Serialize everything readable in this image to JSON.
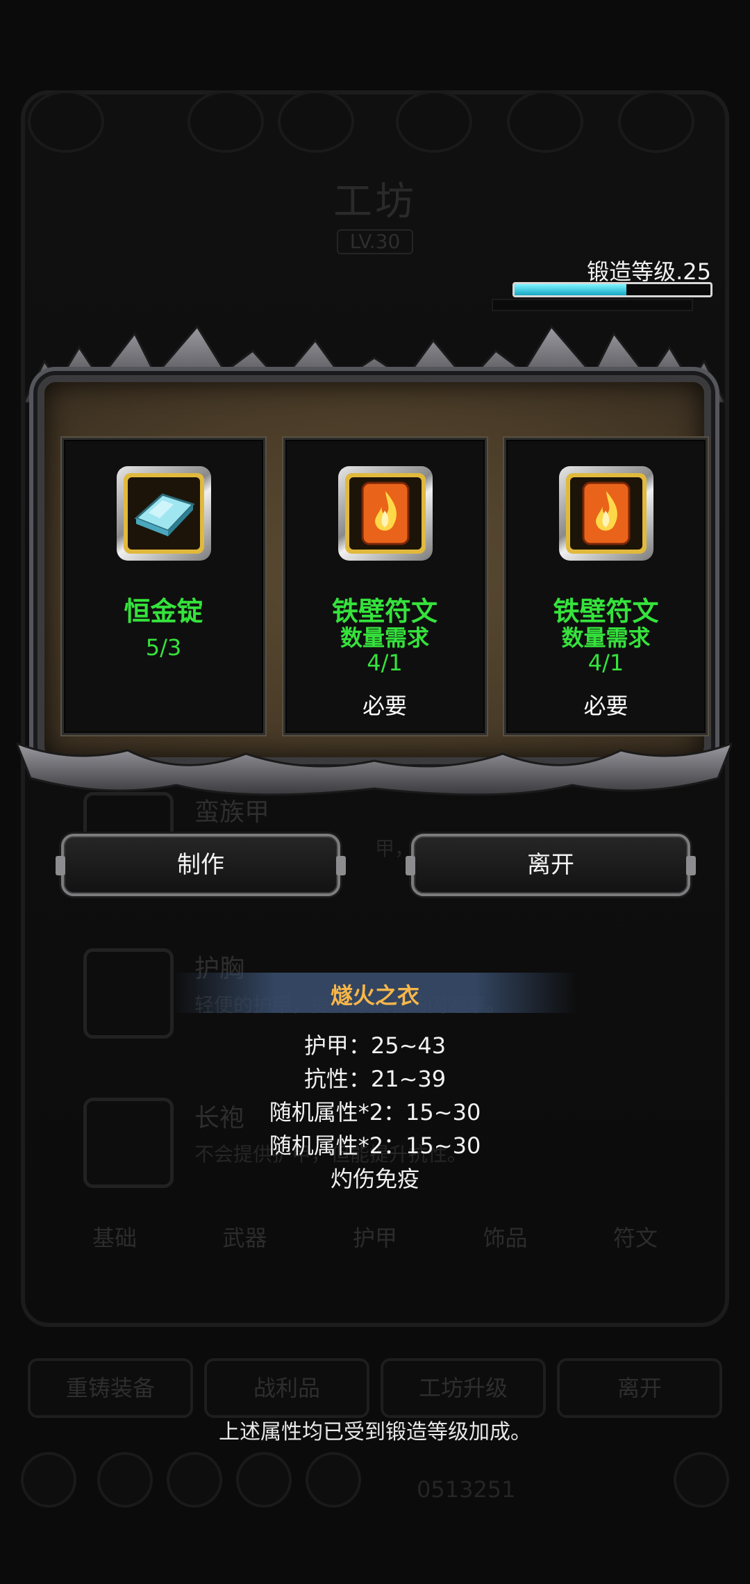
{
  "background": {
    "title": "工坊",
    "level": "LV.30",
    "items": [
      {
        "name": "蛮族甲",
        "desc": "甲，坚固"
      },
      {
        "name": "护胸",
        "desc": "轻便的护甲，提升穿戴者的闪避率。"
      },
      {
        "name": "长袍",
        "desc": "不会提供护甲，但能提升抗性。"
      }
    ],
    "tabs": [
      "基础",
      "武器",
      "护甲",
      "饰品",
      "符文"
    ],
    "bottom_buttons": [
      "重铸装备",
      "战利品",
      "工坊升级",
      "离开"
    ],
    "counter": "0513251"
  },
  "forge": {
    "label": "锻造等级.25",
    "progress": 0.57
  },
  "materials": [
    {
      "name": "恒金锭",
      "sub": "",
      "count": "5/3",
      "required": "",
      "icon": "ingot-icon"
    },
    {
      "name": "铁壁符文",
      "sub": "数量需求",
      "count": "4/1",
      "required": "必要",
      "icon": "fire-rune-icon"
    },
    {
      "name": "铁壁符文",
      "sub": "数量需求",
      "count": "4/1",
      "required": "必要",
      "icon": "fire-rune-icon"
    }
  ],
  "actions": {
    "make": "制作",
    "leave": "离开"
  },
  "tooltip": {
    "title": "燧火之衣",
    "lines": [
      "护甲：25~43",
      "抗性：21~39",
      "随机属性*2：15~30",
      "随机属性*2：15~30",
      "灼伤免疫"
    ]
  },
  "footnote": "上述属性均已受到锻造等级加成。",
  "colors": {
    "material_text": "#35e33c",
    "tooltip_title": "#f7b64a",
    "progress_fill": "#16a8c4"
  }
}
